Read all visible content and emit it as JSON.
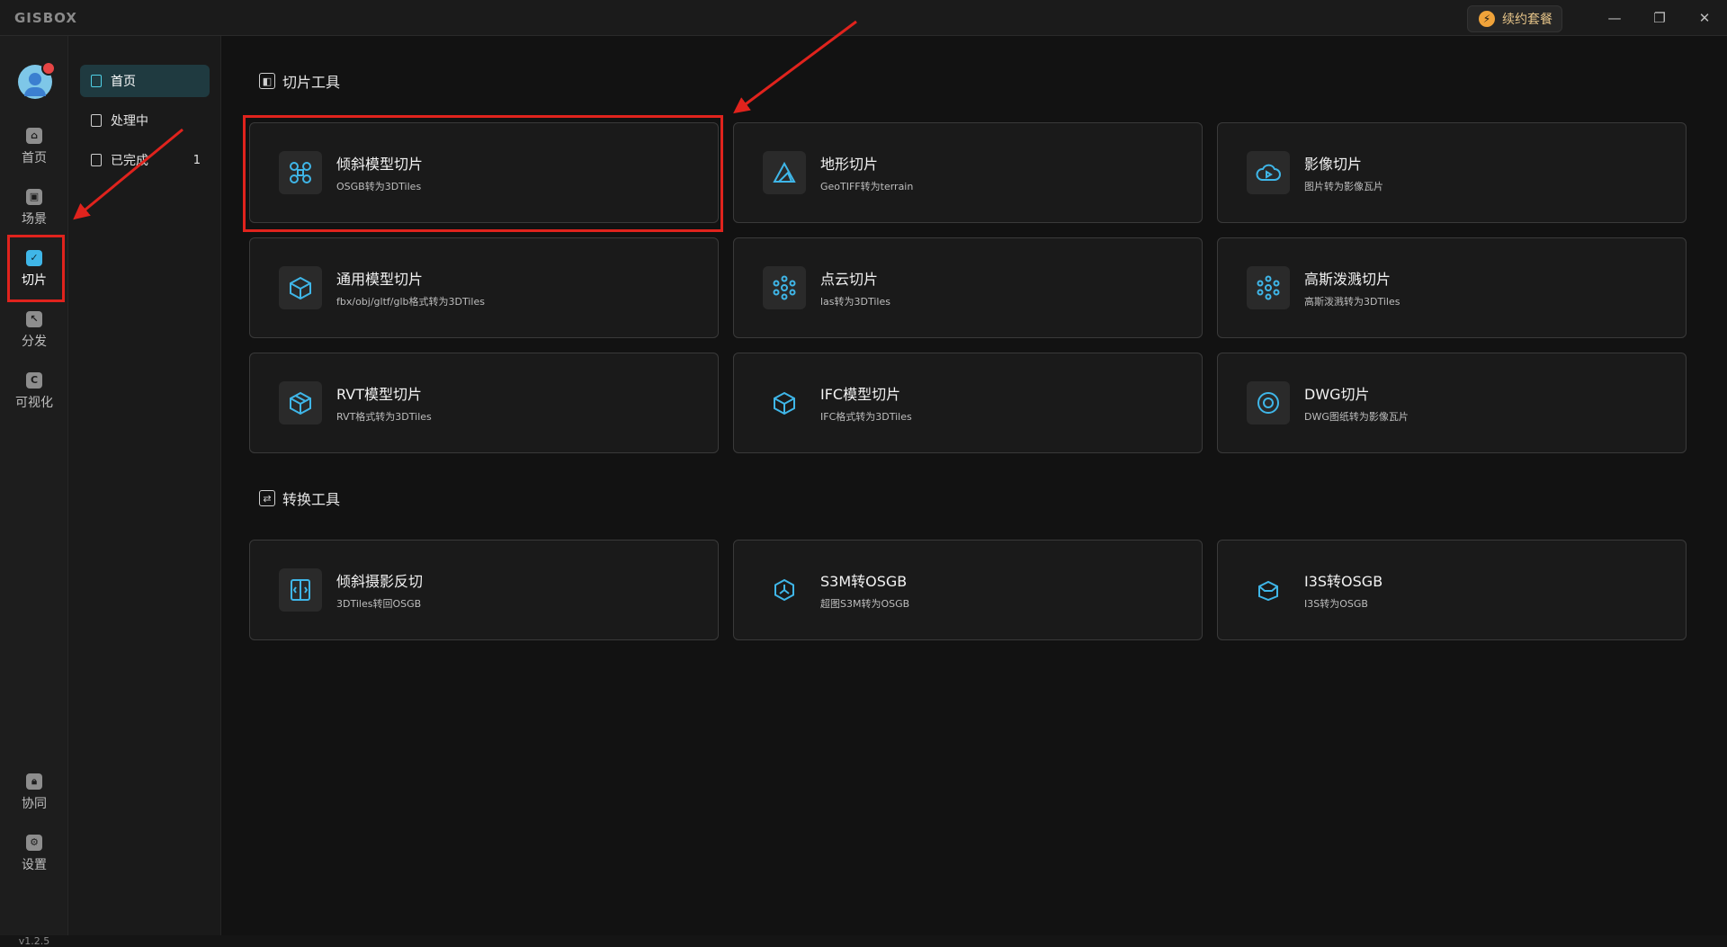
{
  "app": {
    "logo": "GISBOX",
    "subscribe_label": "续约套餐",
    "version": "v1.2.5"
  },
  "window_controls": {
    "minimize": "—",
    "restore": "❐",
    "close": "✕"
  },
  "rail": {
    "items": [
      {
        "label": "首页",
        "icon": "home-icon"
      },
      {
        "label": "场景",
        "icon": "box-icon"
      },
      {
        "label": "切片",
        "icon": "tile-check-icon"
      },
      {
        "label": "分发",
        "icon": "export-icon"
      },
      {
        "label": "可视化",
        "icon": "visual-icon"
      }
    ],
    "bottom_items": [
      {
        "label": "协同",
        "icon": "lock-icon"
      },
      {
        "label": "设置",
        "icon": "gear-icon"
      }
    ]
  },
  "subnav": {
    "items": [
      {
        "label": "首页"
      },
      {
        "label": "处理中"
      },
      {
        "label": "已完成",
        "count": "1"
      }
    ]
  },
  "sections": {
    "tiling_title": "切片工具",
    "convert_title": "转换工具"
  },
  "tiling_tools": [
    {
      "title": "倾斜模型切片",
      "subtitle": "OSGB转为3DTiles",
      "icon": "drone-icon"
    },
    {
      "title": "地形切片",
      "subtitle": "GeoTIFF转为terrain",
      "icon": "terrain-icon"
    },
    {
      "title": "影像切片",
      "subtitle": "图片转为影像瓦片",
      "icon": "cloud-play-icon"
    },
    {
      "title": "通用模型切片",
      "subtitle": "fbx/obj/gltf/glb格式转为3DTiles",
      "icon": "cube-icon"
    },
    {
      "title": "点云切片",
      "subtitle": "las转为3DTiles",
      "icon": "point-cloud-icon"
    },
    {
      "title": "高斯泼溅切片",
      "subtitle": "高斯泼溅转为3DTiles",
      "icon": "gaussian-icon"
    },
    {
      "title": "RVT模型切片",
      "subtitle": "RVT格式转为3DTiles",
      "icon": "rvt-cube-icon"
    },
    {
      "title": "IFC模型切片",
      "subtitle": "IFC格式转为3DTiles",
      "icon": "ifc-cube-icon"
    },
    {
      "title": "DWG切片",
      "subtitle": "DWG图纸转为影像瓦片",
      "icon": "dwg-circle-icon"
    }
  ],
  "convert_tools": [
    {
      "title": "倾斜摄影反切",
      "subtitle": "3DTiles转回OSGB",
      "icon": "reverse-icon"
    },
    {
      "title": "S3M转OSGB",
      "subtitle": "超图S3M转为OSGB",
      "icon": "hexagon-icon"
    },
    {
      "title": "I3S转OSGB",
      "subtitle": "I3S转为OSGB",
      "icon": "box-open-icon"
    }
  ],
  "colors": {
    "accent": "#3fb6e8",
    "annotation_red": "#e0231d",
    "background": "#121212"
  }
}
